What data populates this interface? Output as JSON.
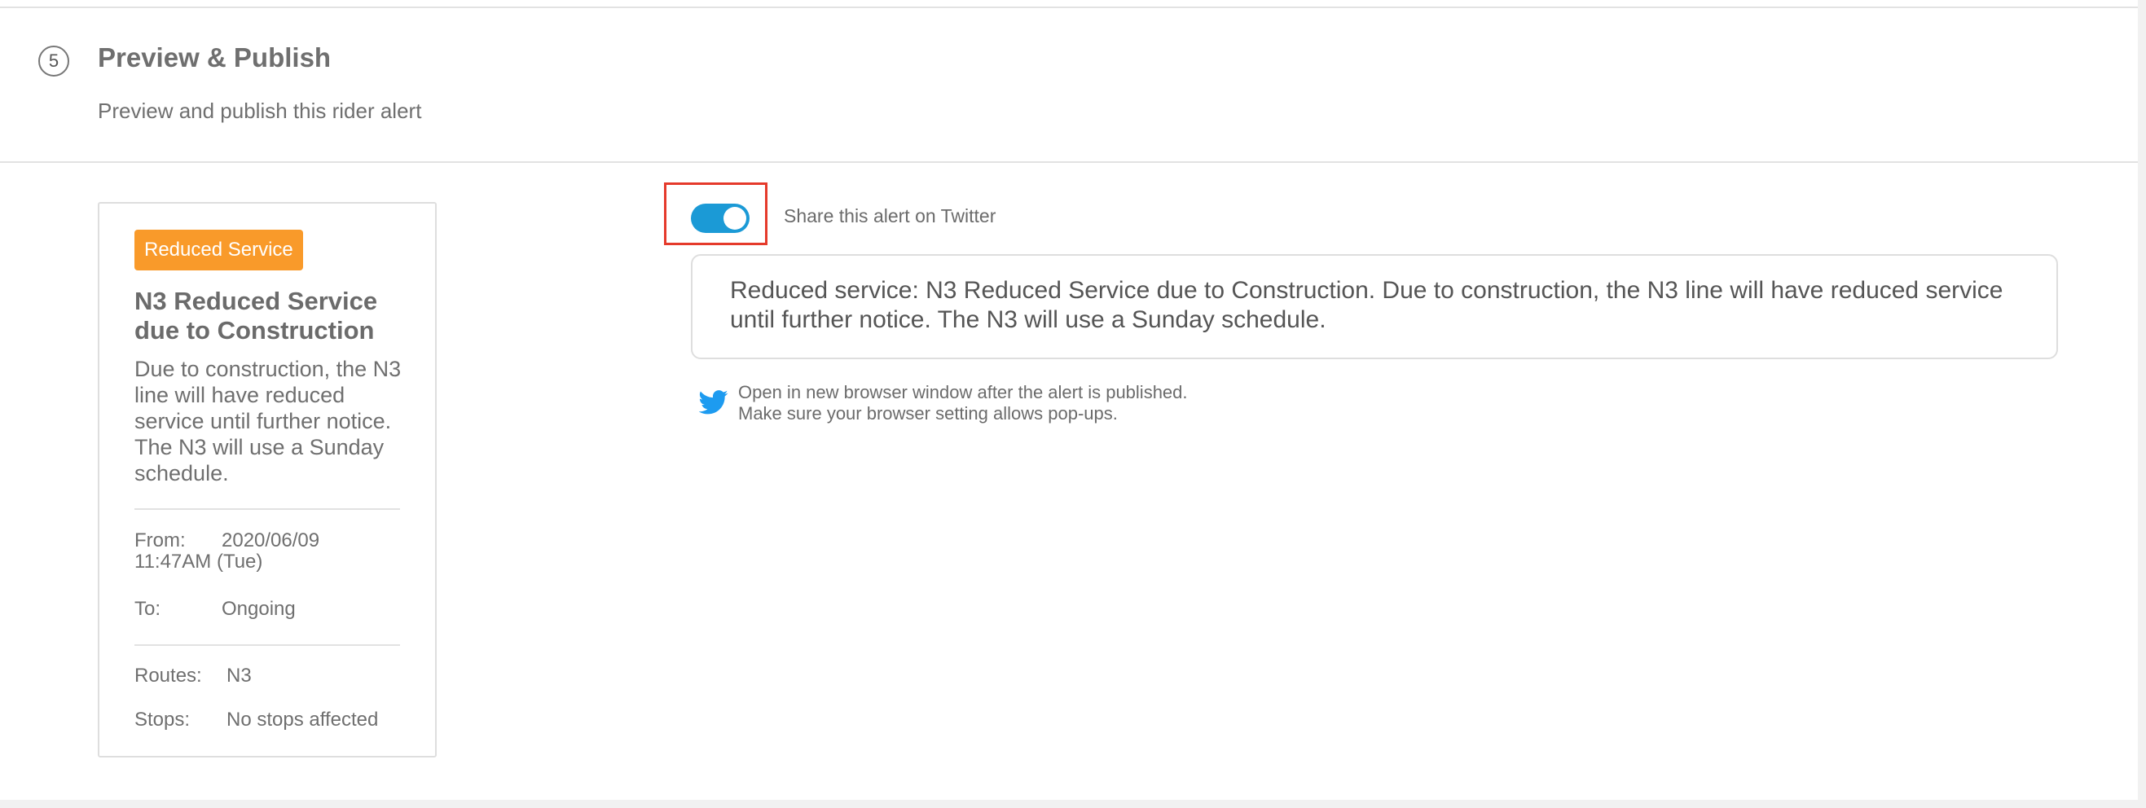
{
  "step": {
    "number": "5",
    "title": "Preview & Publish",
    "subtitle": "Preview and publish this rider alert"
  },
  "preview": {
    "badge": "Reduced Service",
    "badge_color": "#f99a2a",
    "title": "N3 Reduced Service due to Construction",
    "description": "Due to construction, the N3 line will have reduced service until further notice. The N3 will use a Sunday schedule.",
    "from_label": "From:",
    "from_value": "2020/06/09",
    "from_time": "11:47AM (Tue)",
    "to_label": "To:",
    "to_value": "Ongoing",
    "routes_label": "Routes:",
    "routes_value": "N3",
    "stops_label": "Stops:",
    "stops_value": "No stops affected"
  },
  "twitter": {
    "toggle_on": true,
    "toggle_color": "#1b9ad6",
    "toggle_label": "Share this alert on Twitter",
    "tweet_text": "Reduced service: N3 Reduced Service due to Construction. Due to construction, the N3 line will have reduced service until further notice. The N3 will use a Sunday schedule.",
    "icon": "twitter-bird-icon",
    "note_line1": "Open in new browser window after the alert is published.",
    "note_line2": "Make sure your browser setting allows pop-ups."
  }
}
